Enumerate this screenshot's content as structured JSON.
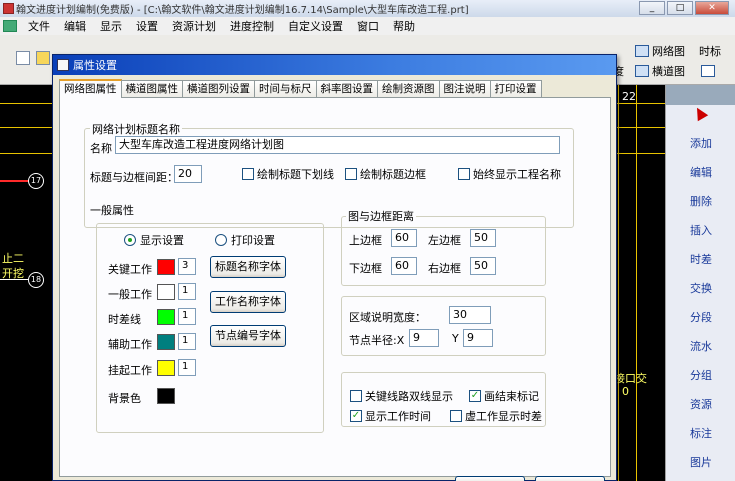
{
  "app": {
    "title": "翰文进度计划编制(免费版) - [C:\\翰文软件\\翰文进度计划编制16.7.14\\Sample\\大型车库改造工程.prt]",
    "win_minimize": "_",
    "win_restore": "□",
    "win_close": "✕"
  },
  "menu": [
    "文件",
    "编辑",
    "显示",
    "设置",
    "资源计划",
    "进度控制",
    "自定义设置",
    "窗口",
    "帮助"
  ],
  "toolbar": {
    "network_label": "网络图",
    "timescale_label": "时标",
    "gantt_label": "横道图",
    "unit_label": "度"
  },
  "canvas": {
    "top_number": "22",
    "node_17": "17",
    "node_18": "18",
    "left_text1": "止二",
    "left_text2": "开挖",
    "right_text": "接口交",
    "right_num": "0"
  },
  "right_panel": [
    "添加",
    "编辑",
    "删除",
    "插入",
    "时差",
    "交换",
    "分段",
    "流水",
    "分组",
    "资源",
    "标注",
    "图片"
  ],
  "dialog": {
    "title": "属性设置",
    "tabs": [
      "网络图属性",
      "横道图属性",
      "横道图列设置",
      "时间与标尺",
      "斜率图设置",
      "绘制资源图",
      "图注说明",
      "打印设置"
    ],
    "title_group": {
      "legend": "网络计划标题名称",
      "name_label": "名称",
      "name_value": "大型车库改造工程进度网络计划图",
      "margin_label": "标题与边框间距：",
      "margin_value": "20",
      "chk_underline": "绘制标题下划线",
      "chk_border": "绘制标题边框",
      "chk_always_show": "始终显示工程名称"
    },
    "general_group": {
      "legend": "一般属性",
      "radio_display": "显示设置",
      "radio_print": "打印设置",
      "key_work": "关键工作",
      "key_work_val": "3",
      "normal_work": "一般工作",
      "normal_work_val": "1",
      "slack_line": "时差线",
      "slack_line_val": "1",
      "aux_work": "辅助工作",
      "aux_work_val": "1",
      "hang_work": "挂起工作",
      "hang_work_val": "1",
      "bg_color": "背景色",
      "btn_title_font": "标题名称字体",
      "btn_work_font": "工作名称字体",
      "btn_node_font": "节点编号字体",
      "colors": {
        "key": "#ff0000",
        "normal": "#ffffff",
        "slack": "#00ff00",
        "aux": "#007f7f",
        "hang": "#ffff00",
        "bg": "#000000"
      }
    },
    "margin_group": {
      "legend": "图与边框距离",
      "top_label": "上边框",
      "top_value": "60",
      "left_label": "左边框",
      "left_value": "50",
      "bottom_label": "下边框",
      "bottom_value": "60",
      "right_label": "右边框",
      "right_value": "50"
    },
    "region_group": {
      "width_label": "区域说明宽度：",
      "width_value": "30",
      "node_radius_label": "节点半径:X",
      "node_x": "9",
      "y_label": "Y",
      "node_y": "9"
    },
    "check_group": {
      "chk_double_line": "关键线路双线显示",
      "chk_end_mark": "画结束标记",
      "chk_show_time": "显示工作时间",
      "chk_virtual_slack": "虚工作显示时差"
    }
  }
}
